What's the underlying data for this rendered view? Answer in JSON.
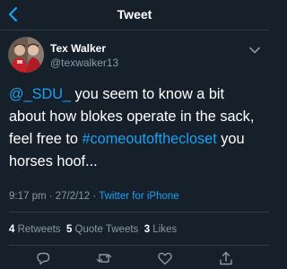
{
  "header": {
    "title": "Tweet",
    "back_icon": "chevron-left-icon"
  },
  "author": {
    "display_name": "Tex Walker",
    "handle": "@texwalker13"
  },
  "tweet": {
    "mention": "@_SDU_",
    "text_part_1": " you seem to know a bit about how blokes operate in the sack, feel free to ",
    "hashtag": "#comeoutofthecloset",
    "text_part_2": " you horses hoof..."
  },
  "meta": {
    "time": "9:17 pm",
    "separator_1": " · ",
    "date": "27/2/12",
    "separator_2": " · ",
    "source": "Twitter for iPhone"
  },
  "stats": {
    "retweets_count": "4",
    "retweets_label": "Retweets",
    "quote_count": "5",
    "quote_label": "Quote Tweets",
    "likes_count": "3",
    "likes_label": "Likes"
  },
  "actions": [
    "reply-icon",
    "retweet-icon",
    "like-icon",
    "share-icon"
  ],
  "colors": {
    "background": "#15202b",
    "accent": "#1da1f2",
    "secondary_text": "#8899a6",
    "divider": "#2f3b47"
  }
}
